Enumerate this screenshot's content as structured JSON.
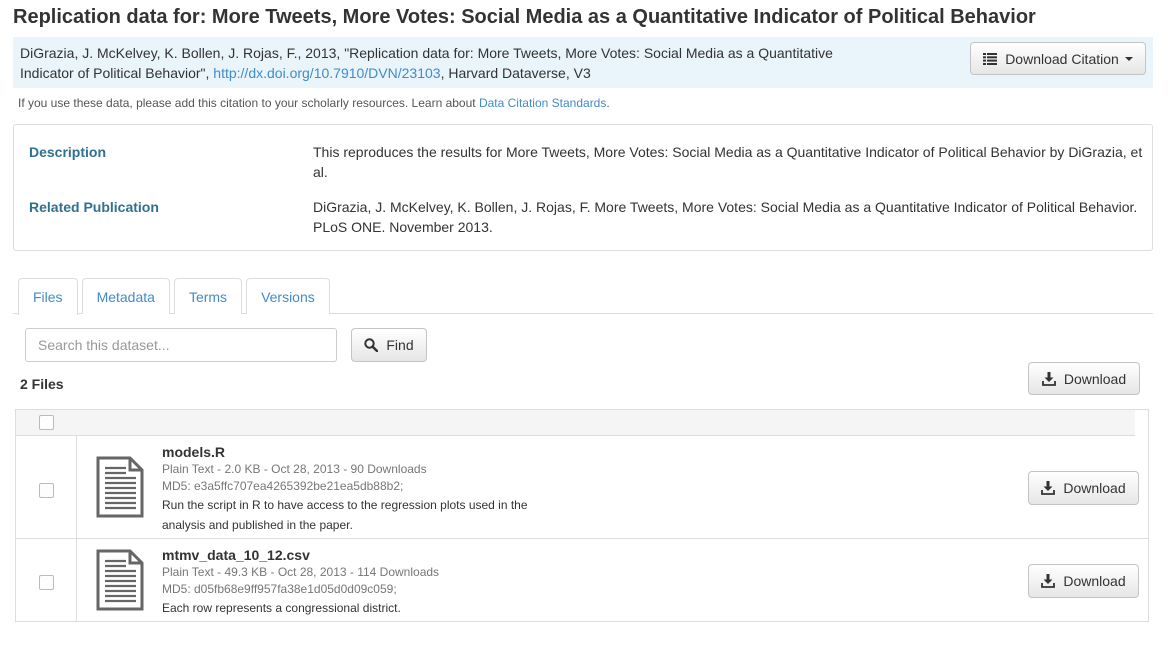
{
  "title": "Replication data for: More Tweets, More Votes: Social Media as a Quantitative Indicator of Political Behavior",
  "citation": {
    "text_before": "DiGrazia, J. McKelvey, K. Bollen, J. Rojas, F., 2013, \"Replication data for: More Tweets, More Votes: Social Media as a Quantitative Indicator of Political Behavior\", ",
    "doi_link": "http://dx.doi.org/10.7910/DVN/23103",
    "text_after": ", Harvard Dataverse, V3",
    "note_text": "If you use these data, please add this citation to your scholarly resources. Learn about ",
    "note_link": "Data Citation Standards",
    "note_end": ".",
    "download_button": "Download Citation"
  },
  "metadata": {
    "description_label": "Description",
    "description_value": "This reproduces the results for More Tweets, More Votes: Social Media as a Quantitative Indicator of Political Behavior by DiGrazia, et al.",
    "publication_label": "Related Publication",
    "publication_value": "DiGrazia, J. McKelvey, K. Bollen, J. Rojas, F. More Tweets, More Votes: Social Media as a Quantitative Indicator of Political Behavior. PLoS ONE. November 2013."
  },
  "tabs": [
    {
      "label": "Files",
      "active": true
    },
    {
      "label": "Metadata",
      "active": false
    },
    {
      "label": "Terms",
      "active": false
    },
    {
      "label": "Versions",
      "active": false
    }
  ],
  "search": {
    "placeholder": "Search this dataset...",
    "find_button": "Find"
  },
  "files_count": "2 Files",
  "download_all_button": "Download",
  "files": [
    {
      "name": "models.R",
      "meta": "Plain Text - 2.0 KB - Oct 28, 2013 - 90 Downloads",
      "md5": "MD5: e3a5ffc707ea4265392be21ea5db88b2;",
      "description": "Run the script in R to have access to the regression plots used in the analysis and published in the paper.",
      "download_button": "Download"
    },
    {
      "name": "mtmv_data_10_12.csv",
      "meta": "Plain Text - 49.3 KB - Oct 28, 2013 - 114 Downloads",
      "md5": "MD5: d05fb68e9ff957fa38e1d05d0d09c059;",
      "description": "Each row represents a congressional district.",
      "download_button": "Download"
    }
  ],
  "icons": {
    "list": "list-icon",
    "search": "search-icon",
    "download": "download-icon",
    "file": "document-icon"
  }
}
